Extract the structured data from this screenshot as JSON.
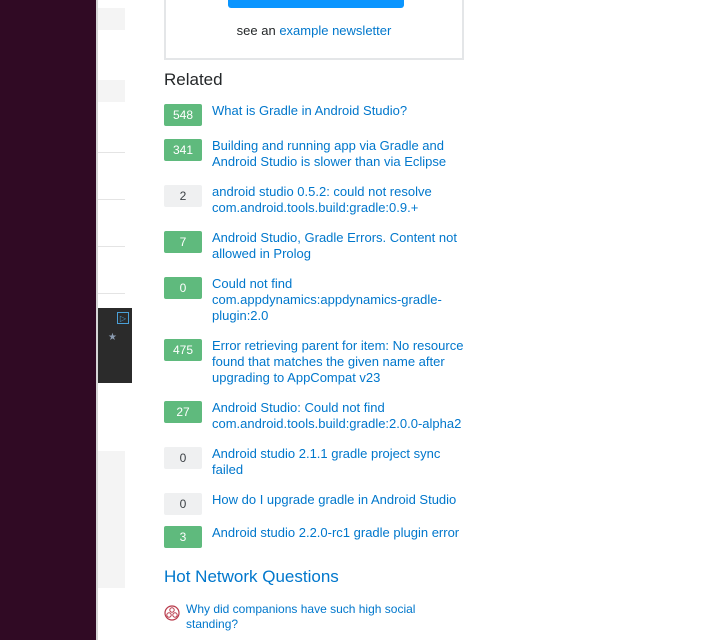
{
  "newsletter": {
    "prefix": "see an",
    "link_label": "example newsletter"
  },
  "related": {
    "heading": "Related",
    "items": [
      {
        "count": "548",
        "answered": true,
        "title": "What is Gradle in Android Studio?"
      },
      {
        "count": "341",
        "answered": true,
        "title": "Building and running app via Gradle and Android Studio is slower than via Eclipse"
      },
      {
        "count": "2",
        "answered": false,
        "title": "android studio 0.5.2: could not resolve com.android.tools.build:gradle:0.9.+"
      },
      {
        "count": "7",
        "answered": true,
        "title": "Android Studio, Gradle Errors. Content not allowed in Prolog"
      },
      {
        "count": "0",
        "answered": true,
        "title": "Could not find com.appdynamics:appdynamics-gradle-plugin:2.0"
      },
      {
        "count": "475",
        "answered": true,
        "title": "Error retrieving parent for item: No resource found that matches the given name after upgrading to AppCompat v23"
      },
      {
        "count": "27",
        "answered": true,
        "title": "Android Studio: Could not find com.android.tools.build:gradle:2.0.0-alpha2"
      },
      {
        "count": "0",
        "answered": false,
        "title": "Android studio 2.1.1 gradle project sync failed"
      },
      {
        "count": "0",
        "answered": false,
        "title": "How do I upgrade gradle in Android Studio"
      },
      {
        "count": "3",
        "answered": true,
        "title": "Android studio 2.2.0-rc1 gradle plugin error"
      }
    ]
  },
  "hot_network": {
    "heading": "Hot Network Questions",
    "items": [
      {
        "icon": "rpg-site-icon",
        "title": "Why did companions have such high social standing?"
      }
    ]
  },
  "colors": {
    "answered_badge": "#5fba7d",
    "unanswered_badge": "#eff0f1",
    "link": "#0077cc",
    "sidebar_bg": "#300a24"
  }
}
